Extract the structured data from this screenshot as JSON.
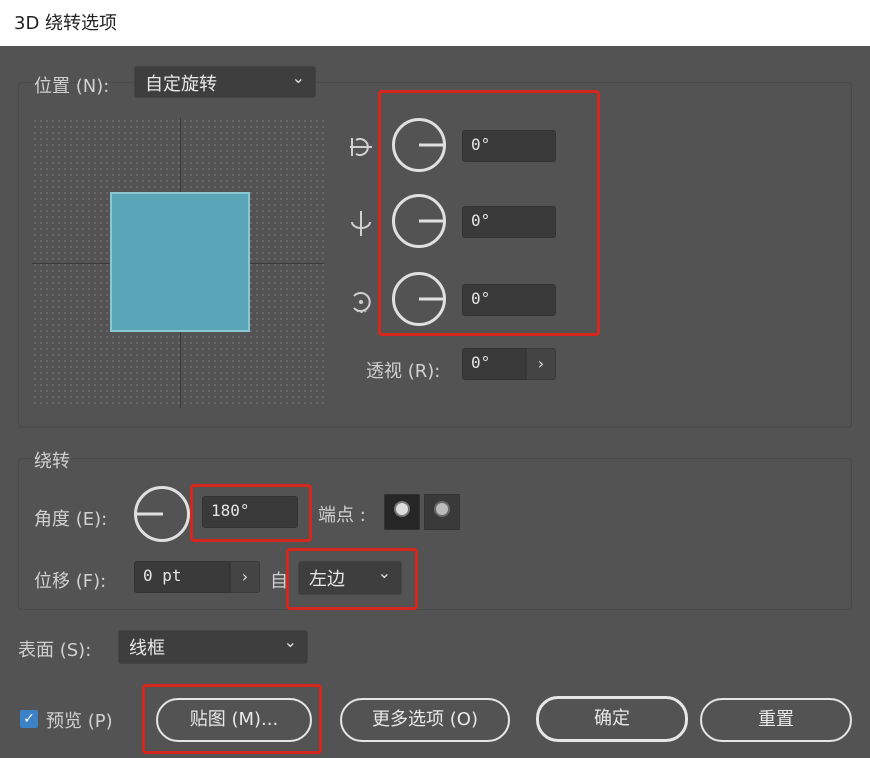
{
  "window": {
    "title": "3D 绕转选项"
  },
  "position": {
    "label": "位置 (N):",
    "preset": "自定旋转",
    "x_angle": "0°",
    "y_angle": "0°",
    "z_angle": "0°",
    "perspective_label": "透视 (R):",
    "perspective_value": "0°"
  },
  "revolve": {
    "group_label": "绕转",
    "angle_label": "角度 (E):",
    "angle_value": "180°",
    "cap_label": "端点 :",
    "offset_label": "位移 (F):",
    "offset_value": "0 pt",
    "from_label": "自",
    "from_value": "左边"
  },
  "surface": {
    "label": "表面 (S):",
    "value": "线框"
  },
  "footer": {
    "preview_label": "预览 (P)",
    "preview_checked": true,
    "map_button": "贴图 (M)...",
    "more_options_button": "更多选项 (O)",
    "ok_button": "确定",
    "reset_button": "重置"
  },
  "colors": {
    "cube": "#5aa5b8",
    "highlight": "#d6271f",
    "checkbox": "#3b82c6"
  }
}
